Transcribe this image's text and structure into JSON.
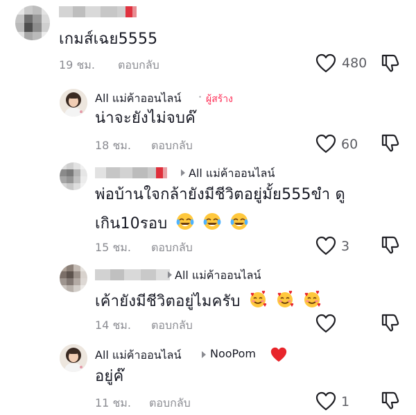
{
  "comments": [
    {
      "text": "เกมส์เฉย5555",
      "time": "19 ชม.",
      "reply": "ตอบกลับ",
      "likes": "480"
    },
    {
      "user": "All แม่ค้าออนไลน์",
      "dot": "·",
      "creator": "ผู้สร้าง",
      "text": "น่าจะยังไม่จบค๊",
      "time": "18 ชม.",
      "reply": "ตอบกลับ",
      "likes": "60"
    },
    {
      "reply_to": "All แม่ค้าออนไลน์",
      "text_line1": "พ่อบ้านใจกล้ายังมีชีวิตอยู่มั้ย555ขำ ดู",
      "text_line2": "เกิน10รอบ",
      "emojis": "face-with-tears-of-joy ×3",
      "time": "15 ชม.",
      "reply": "ตอบกลับ",
      "likes": "3"
    },
    {
      "reply_to": "All แม่ค้าออนไลน์",
      "text": "เค้ายังมีชีวิตอยู่ไมครับ",
      "emojis": "smiling-face-with-hearts ×3",
      "time": "14 ชม.",
      "reply": "ตอบกลับ",
      "likes": ""
    },
    {
      "user": "All แม่ค้าออนไลน์",
      "reply_to": "NooPom",
      "text": "อยู่ค๊",
      "time": "11 ชม.",
      "reply": "ตอบกลับ",
      "likes": "1"
    }
  ],
  "colors": {
    "text": "#161823",
    "muted": "#8a8b91",
    "creator": "#fe2c55",
    "heart": "#e8252b"
  }
}
